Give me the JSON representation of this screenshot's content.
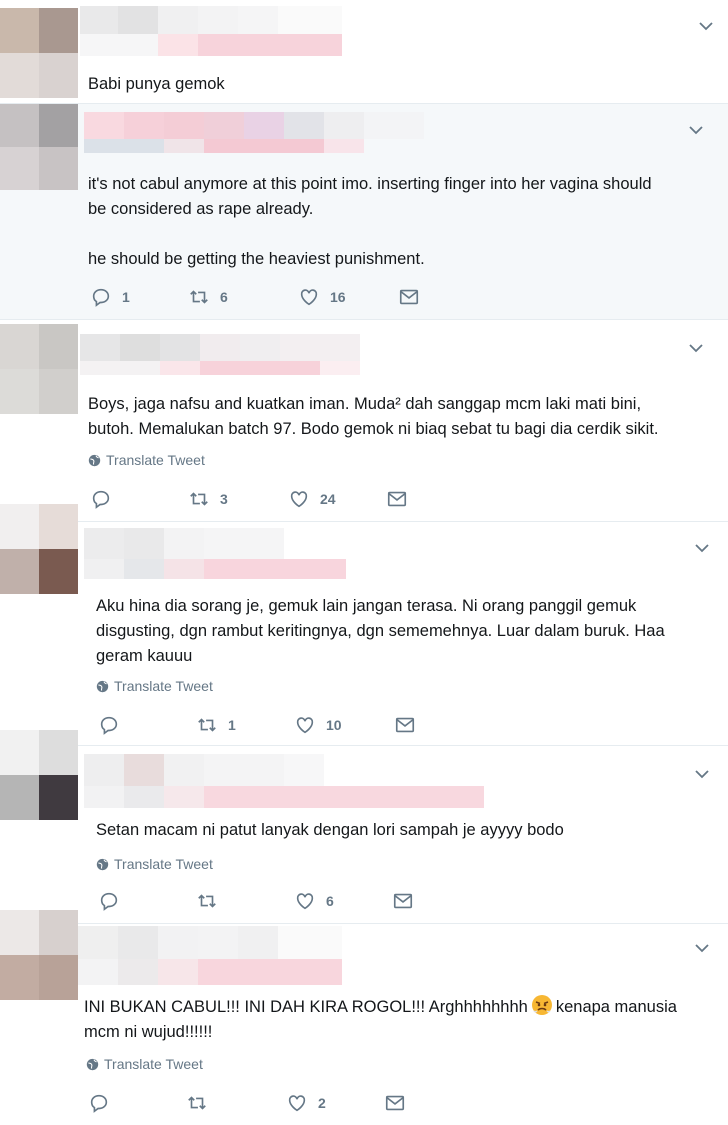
{
  "tweets": [
    {
      "text": "Babi punya gemok",
      "translate_label": "",
      "replies": "",
      "retweets": "",
      "likes": ""
    },
    {
      "text": "it's not cabul anymore at this point imo. inserting finger into her vagina should\nbe considered as rape already.\n\nhe should be getting the heaviest punishment.",
      "translate_label": "",
      "replies": "1",
      "retweets": "6",
      "likes": "16"
    },
    {
      "text": "Boys, jaga nafsu and kuatkan iman. Muda² dah sanggap mcm laki mati bini,\nbutoh. Memalukan batch 97. Bodo gemok ni biaq sebat tu bagi dia cerdik sikit.",
      "translate_label": "Translate Tweet",
      "replies": "",
      "retweets": "3",
      "likes": "24"
    },
    {
      "text": "Aku hina dia sorang je, gemuk lain jangan terasa. Ni orang panggil gemuk\ndisgusting, dgn rambut keritingnya, dgn sememehnya. Luar dalam buruk. Haa\ngeram kauuu",
      "translate_label": "Translate Tweet",
      "replies": "",
      "retweets": "1",
      "likes": "10"
    },
    {
      "text": "Setan macam ni patut lanyak dengan lori sampah je ayyyy bodo",
      "translate_label": "Translate Tweet",
      "replies": "",
      "retweets": "",
      "likes": "6"
    },
    {
      "text_before_emoji": "INI BUKAN CABUL!!! INI DAH KIRA ROGOL!!! Arghhhhhhhh",
      "text_after_emoji": "kenapa manusia\nmcm ni wujud!!!!!!",
      "emoji": "angry-face-emoji",
      "translate_label": "Translate Tweet",
      "replies": "",
      "retweets": "",
      "likes": "2"
    }
  ],
  "icons": {
    "reply": "reply-icon",
    "retweet": "retweet-icon",
    "like": "heart-icon",
    "dm": "envelope-icon",
    "more": "chevron-down-icon",
    "globe": "globe-icon"
  },
  "colors": {
    "text": "#14171a",
    "secondary": "#657786",
    "highlight_bg": "#f5f8fa",
    "border": "#e6ecf0"
  }
}
